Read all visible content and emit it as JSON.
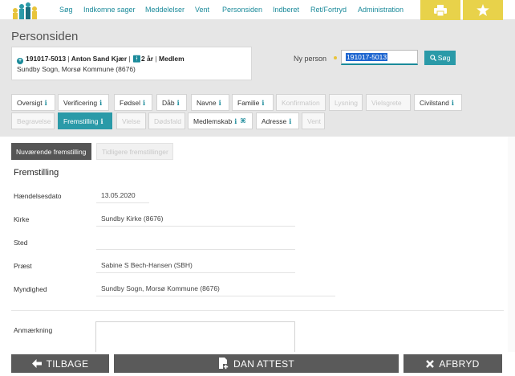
{
  "nav": {
    "links": [
      "Søg",
      "Indkomne sager",
      "Meddelelser",
      "Vent",
      "Personsiden",
      "Indberet",
      "Ret/Fortryd",
      "Administration"
    ],
    "icons": [
      "print-icon",
      "star-icon"
    ],
    "accent": "#1a8a9a",
    "button_color": "#e8d24a"
  },
  "page": {
    "title": "Personsiden"
  },
  "person": {
    "cpr": "191017-5013",
    "name": "Anton Sand Kjær",
    "age": "2 år",
    "status": "Medlem",
    "sep": "|",
    "location": "Sundby Sogn, Morsø Kommune (8676)"
  },
  "search": {
    "label": "Ny person",
    "value": "191017-5013",
    "button": "Søg"
  },
  "tabs": {
    "row1": [
      {
        "label": "Oversigt",
        "info": "i",
        "state": "normal"
      },
      {
        "label": "Verificering",
        "info": "i",
        "state": "normal"
      },
      {
        "label": "Fødsel",
        "info": "i",
        "state": "normal"
      },
      {
        "label": "Dåb",
        "info": "i",
        "state": "normal"
      },
      {
        "label": "Navne",
        "info": "i",
        "state": "normal"
      },
      {
        "label": "Familie",
        "info": "i",
        "state": "normal"
      },
      {
        "label": "Konfirmation",
        "info": "",
        "state": "disabled"
      },
      {
        "label": "Lysning",
        "info": "",
        "state": "disabled"
      },
      {
        "label": "Vielsgrete",
        "info": "",
        "state": "disabled"
      },
      {
        "label": "Civilstand",
        "info": "i",
        "state": "normal"
      }
    ],
    "row2": [
      {
        "label": "Begravelse",
        "info": "",
        "state": "disabled"
      },
      {
        "label": "Fremstilling",
        "info": "i",
        "state": "active"
      },
      {
        "label": "Vielse",
        "info": "",
        "state": "disabled"
      },
      {
        "label": "Dødsfald",
        "info": "",
        "state": "disabled"
      },
      {
        "label": "Medlemskab",
        "info": "i",
        "extra": "⌘",
        "state": "normal"
      },
      {
        "label": "Adresse",
        "info": "i",
        "state": "normal"
      },
      {
        "label": "Vent",
        "info": "",
        "state": "disabled"
      }
    ]
  },
  "subtabs": {
    "current": "Nuværende fremstilling",
    "previous": "Tidligere fremstillinger"
  },
  "section": {
    "title": "Fremstilling",
    "fields": [
      {
        "label": "Hændelsesdato",
        "value": "13.05.2020"
      },
      {
        "label": "Kirke",
        "value": "Sundby Kirke (8676)"
      },
      {
        "label": "Sted",
        "value": ""
      },
      {
        "label": "Præst",
        "value": "Sabine S Bech-Hansen (SBH)"
      },
      {
        "label": "Myndighed",
        "value": "Sundby Sogn, Morsø Kommune (8676)"
      }
    ],
    "remark_label": "Anmærkning"
  },
  "actions": {
    "back": "TILBAGE",
    "create": "DAN ATTEST",
    "cancel": "AFBRYD"
  }
}
